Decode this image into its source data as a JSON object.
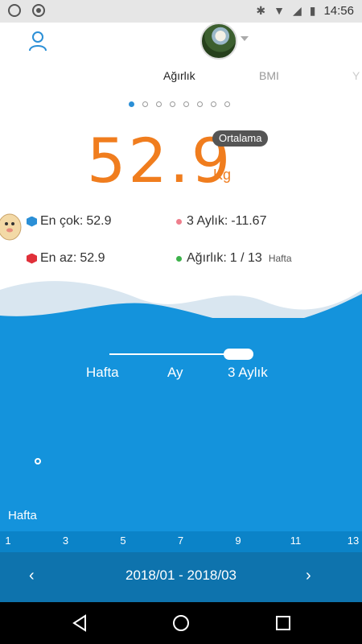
{
  "status_bar": {
    "time": "14:56",
    "left_icons": [
      "whatsapp-icon",
      "settings-circle-icon"
    ],
    "right_icons": [
      "bluetooth-icon",
      "wifi-icon",
      "signal-icon",
      "battery-icon"
    ]
  },
  "header": {
    "profile_icon": "person-icon",
    "avatar": "user-avatar"
  },
  "tabs": {
    "active": "Ağırlık",
    "second": "BMI",
    "third_partial": "Y"
  },
  "pager": {
    "count": 8,
    "active_index": 0
  },
  "weight": {
    "value": "52.9",
    "unit": "Kg",
    "badge": "Ortalama"
  },
  "stats": {
    "max_label": "En çok:",
    "max_value": "52.9",
    "min_label": "En az:",
    "min_value": "52.9",
    "change_label": "3 Aylık:",
    "change_value": "-11.67",
    "count_label": "Ağırlık:",
    "count_value": "1 / 13",
    "count_unit": "Hafta"
  },
  "range_selector": {
    "options": [
      "Hafta",
      "Ay",
      "3 Aylık"
    ],
    "selected": "3 Aylık"
  },
  "chart": {
    "y_caption": "Hafta",
    "x_ticks": [
      "1",
      "3",
      "5",
      "7",
      "9",
      "11",
      "13"
    ]
  },
  "date_nav": {
    "prev": "‹",
    "range": "2018/01 - 2018/03",
    "next": "›"
  },
  "colors": {
    "accent_orange": "#f07d1e",
    "chart_blue": "#1493dc",
    "dark_blue": "#0e73ad",
    "badge_gray": "#555555"
  },
  "chart_data": {
    "type": "scatter",
    "x": [
      1
    ],
    "y": [
      52.9
    ],
    "xlabel": "Hafta",
    "x_ticks": [
      1,
      3,
      5,
      7,
      9,
      11,
      13
    ],
    "xlim": [
      1,
      13
    ]
  }
}
